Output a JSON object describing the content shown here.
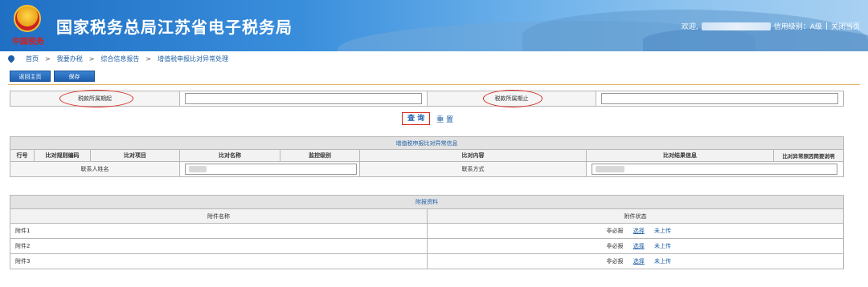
{
  "header": {
    "title": "国家税务总局江苏省电子税务局",
    "emblem_text": "中国税务",
    "welcome": "欢迎,",
    "credit_level": "信用级别：A级",
    "close_page": "关闭当页"
  },
  "breadcrumb": [
    "首页",
    "我要办税",
    "综合信息报告",
    "增值税申报比对异常处理"
  ],
  "toolbar": {
    "back_label": "返回主页",
    "save_label": "保存"
  },
  "search": {
    "period_start_label": "税款所属期起",
    "period_end_label": "税款所属期止",
    "query_label": "查 询",
    "reset_label": "重 置"
  },
  "anomaly_table": {
    "caption": "增值税申报比对异常信息",
    "headers": [
      "行号",
      "比对规则编码",
      "比对项目",
      "比对名称",
      "监控级别",
      "比对内容",
      "比对结果信息",
      "比对异常原因简要说明"
    ],
    "contact_name_label": "联系人姓名",
    "contact_method_label": "联系方式"
  },
  "attachments": {
    "caption": "附报资料",
    "headers": [
      "附件名称",
      "附件状态"
    ],
    "rows": [
      {
        "name": "附件1",
        "required": "非必报",
        "select": "选择",
        "status": "未上传"
      },
      {
        "name": "附件2",
        "required": "非必报",
        "select": "选择",
        "status": "未上传"
      },
      {
        "name": "附件3",
        "required": "非必报",
        "select": "选择",
        "status": "未上传"
      }
    ]
  },
  "colors": {
    "banner": "#1f6fc4",
    "link": "#1d5fa6",
    "highlight": "#d8281a",
    "divider": "#e0b66a"
  }
}
